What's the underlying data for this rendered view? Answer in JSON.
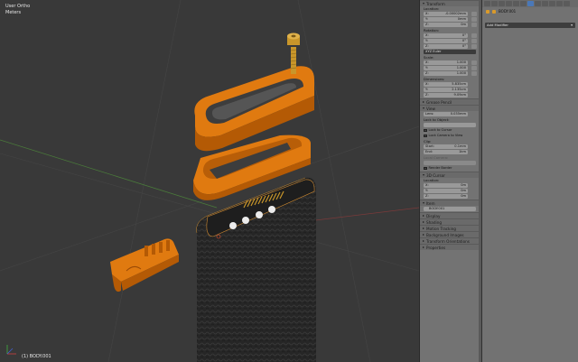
{
  "viewport": {
    "view_name": "User Ortho",
    "units": "Meters",
    "object_label": "(1) BODY.001"
  },
  "npanel": {
    "transform": {
      "title": "Transform",
      "location_label": "Location:",
      "location": [
        {
          "axis": "X:",
          "value": "-0.00002mm"
        },
        {
          "axis": "Y:",
          "value": "0mm"
        },
        {
          "axis": "Z:",
          "value": "0m"
        }
      ],
      "rotation_label": "Rotation:",
      "rotation": [
        {
          "axis": "X:",
          "value": "0°"
        },
        {
          "axis": "Y:",
          "value": "0°"
        },
        {
          "axis": "Z:",
          "value": "0°"
        }
      ],
      "rotation_mode": "XYZ Euler",
      "scale_label": "Scale:",
      "scale": [
        {
          "axis": "X:",
          "value": "1.000"
        },
        {
          "axis": "Y:",
          "value": "1.000"
        },
        {
          "axis": "Z:",
          "value": "1.000"
        }
      ],
      "dimensions_label": "Dimensions:",
      "dimensions": [
        {
          "axis": "X:",
          "value": "5.835cm"
        },
        {
          "axis": "Y:",
          "value": "2.135cm"
        },
        {
          "axis": "Z:",
          "value": "9.09cm"
        }
      ]
    },
    "grease_pencil": "Grease Pencil",
    "view": {
      "title": "View",
      "lens_label": "Lens:",
      "lens_value": "0.035mm",
      "lock_to_object": "Lock to Object:",
      "lock_to_cursor": "Lock to Cursor",
      "lock_camera": "Lock Camera to View",
      "clip_label": "Clip:",
      "clip_start_label": "Start:",
      "clip_start": "0.1mm",
      "clip_end_label": "End:",
      "clip_end": "1km",
      "local_camera": "Local Camera:",
      "render_border": "Render Border"
    },
    "cursor": {
      "title": "3D Cursor",
      "location_label": "Location:",
      "location": [
        {
          "axis": "X:",
          "value": "0m"
        },
        {
          "axis": "Y:",
          "value": "0m"
        },
        {
          "axis": "Z:",
          "value": "0m"
        }
      ]
    },
    "item": {
      "title": "Item",
      "name": "BODY.001"
    },
    "collapsed": [
      "Display",
      "Shading",
      "Motion Tracking",
      "Background Images",
      "Transform Orientations",
      "Properties"
    ]
  },
  "modifiers": {
    "object_name": "BODY.001",
    "add_modifier": "Add Modifier"
  },
  "colors": {
    "orange": "#e07a10",
    "brass": "#c9962a",
    "leather": "#2a2a2a",
    "accent_blue": "#4a78b8"
  }
}
